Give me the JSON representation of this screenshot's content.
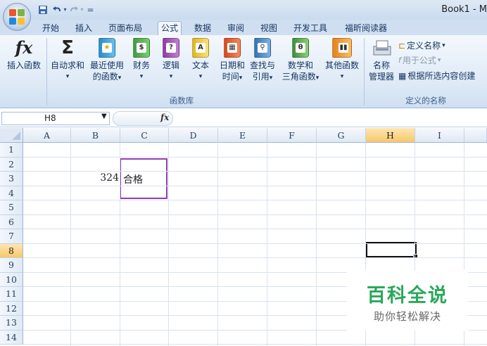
{
  "window": {
    "title": "Book1 - M"
  },
  "quick_access": {
    "save": "save-icon",
    "undo": "undo-icon",
    "redo": "redo-icon",
    "customize": "="
  },
  "tabs": [
    {
      "label": "开始"
    },
    {
      "label": "插入"
    },
    {
      "label": "页面布局"
    },
    {
      "label": "公式",
      "active": true
    },
    {
      "label": "数据"
    },
    {
      "label": "审阅"
    },
    {
      "label": "视图"
    },
    {
      "label": "开发工具"
    },
    {
      "label": "福昕阅读器"
    }
  ],
  "ribbon": {
    "insert_function": {
      "icon_text": "fx",
      "label": "插入函数"
    },
    "autosum": {
      "icon_text": "Σ",
      "label": "自动求和",
      "dropdown": "▾"
    },
    "recent": {
      "line1": "最近使用",
      "line2": "的函数",
      "dropdown": "▾"
    },
    "financial": {
      "label": "财务",
      "dropdown": "▾"
    },
    "logical": {
      "label": "逻辑",
      "dropdown": "▾"
    },
    "text": {
      "label": "文本",
      "dropdown": "▾"
    },
    "datetime": {
      "line1": "日期和",
      "line2": "时间",
      "dropdown": "▾"
    },
    "lookup": {
      "line1": "查找与",
      "line2": "引用",
      "dropdown": "▾"
    },
    "math": {
      "line1": "数学和",
      "line2": "三角函数",
      "dropdown": "▾"
    },
    "other": {
      "label": "其他函数",
      "dropdown": "▾"
    },
    "group_library": "函数库",
    "name_manager": {
      "line1": "名称",
      "line2": "管理器"
    },
    "define_name": "定义名称",
    "use_in_formula": "用于公式",
    "create_from_selection": "根据所选内容创建",
    "group_names": "定义的名称"
  },
  "formula_bar": {
    "name_box": "H8",
    "fx": "fx",
    "formula": ""
  },
  "columns": [
    "A",
    "B",
    "C",
    "D",
    "E",
    "F",
    "G",
    "H",
    "I"
  ],
  "rows": [
    "1",
    "2",
    "3",
    "4",
    "5",
    "6",
    "7",
    "8",
    "9",
    "10",
    "11",
    "12",
    "13",
    "14"
  ],
  "cells": {
    "B3": "324",
    "C3": "合格"
  },
  "selection": {
    "active_cell": "H8",
    "highlight_color": "#8e3fb5"
  },
  "watermark": {
    "title": "百科全说",
    "subtitle": "助你轻松解决"
  }
}
